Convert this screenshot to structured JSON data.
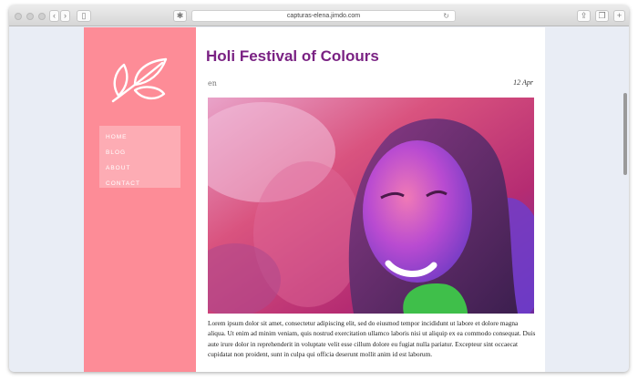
{
  "browser": {
    "url": "capturas-elena.jimdo.com"
  },
  "site": {
    "nav": [
      {
        "label": "HOME"
      },
      {
        "label": "BLOG"
      },
      {
        "label": "ABOUT"
      },
      {
        "label": "CONTACT"
      }
    ],
    "colors": {
      "sidebar": "#fd8c97",
      "title": "#7a2283"
    }
  },
  "post": {
    "title": "Holi Festival of Colours",
    "lang": "en",
    "date": "12 Apr",
    "body": "Lorem ipsum dolor sit amet, consectetur adipiscing elit, sed do eiusmod tempor incididunt ut labore et dolore magna aliqua. Ut enim ad minim veniam, quis nostrud exercitation ullamco laboris nisi ut aliquip ex ea commodo consequat. Duis aute irure dolor in reprehenderit in voluptate velit esse cillum dolore eu fugiat nulla pariatur. Excepteur sint occaecat cupidatat non proident, sunt in culpa qui officia deserunt mollit anim id est laborum."
  }
}
